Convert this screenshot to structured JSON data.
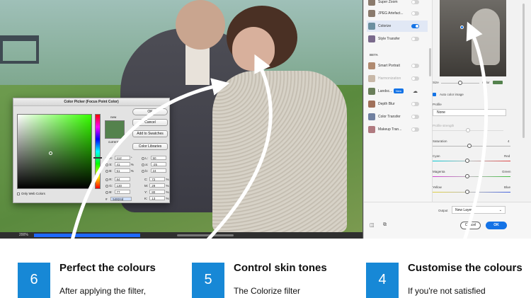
{
  "picker": {
    "title": "Color Picker (Focus Point Color)",
    "new_label": "new",
    "current_label": "current",
    "ok": "OK",
    "cancel": "Cancel",
    "add_swatches": "Add to Swatches",
    "color_libraries": "Color Libraries",
    "only_web": "Only Web Colors",
    "hex_prefix": "#",
    "hex": "54824d",
    "color": "#54824d",
    "fields": [
      {
        "k": "H:",
        "v": "112",
        "u": "°"
      },
      {
        "k": "S:",
        "v": "41",
        "u": "%"
      },
      {
        "k": "B:",
        "v": "51",
        "u": "%"
      },
      {
        "k": "R:",
        "v": "84",
        "u": ""
      },
      {
        "k": "G:",
        "v": "130",
        "u": ""
      },
      {
        "k": "B:",
        "v": "77",
        "u": ""
      }
    ],
    "lab": [
      {
        "k": "L:",
        "v": "50"
      },
      {
        "k": "a:",
        "v": "-25"
      },
      {
        "k": "b:",
        "v": "24"
      }
    ],
    "cmyk": [
      {
        "k": "C:",
        "v": "72",
        "u": "%"
      },
      {
        "k": "M:",
        "v": "29",
        "u": "%"
      },
      {
        "k": "Y:",
        "v": "80",
        "u": "%"
      },
      {
        "k": "K:",
        "v": "13",
        "u": "%"
      }
    ]
  },
  "status": {
    "zoom": "200%"
  },
  "filters": {
    "items": [
      {
        "name": "Super Zoom",
        "toggle": "off"
      },
      {
        "name": "JPEG Artefact...",
        "toggle": "off"
      },
      {
        "name": "Colorize",
        "toggle": "on"
      },
      {
        "name": "Style Transfer",
        "toggle": "off"
      },
      {
        "name": "Smart Portrait",
        "toggle": "off"
      },
      {
        "name": "Harmonization",
        "toggle": "off"
      },
      {
        "name": "Landsc...",
        "badge": "New"
      },
      {
        "name": "Depth Blur",
        "toggle": "off"
      },
      {
        "name": "Color Transfer",
        "toggle": "off"
      },
      {
        "name": "Makeup Tran...",
        "toggle": "off"
      }
    ],
    "beta_label": "BETA"
  },
  "settings": {
    "size_label": "Size",
    "color_label": "Color",
    "auto_color": "Auto color image",
    "profile_label": "Profile",
    "profile_value": "None",
    "profile_strength": "Profile strength",
    "saturation": "Saturation",
    "saturation_value": "4",
    "cyan": "Cyan",
    "red": "Red",
    "magenta": "Magenta",
    "green": "Green",
    "yellow": "Yellow",
    "blue": "Blue"
  },
  "footer": {
    "output_label": "Output",
    "output_value": "New Layer",
    "cancel": "Cancel",
    "ok": "OK"
  },
  "captions": [
    {
      "num": "6",
      "title": "Perfect the colours",
      "body": "After applying the filter,"
    },
    {
      "num": "5",
      "title": "Control skin tones",
      "body": "The Colorize filter"
    },
    {
      "num": "4",
      "title": "Customise the colours",
      "body": "If you're not satisfied"
    }
  ]
}
